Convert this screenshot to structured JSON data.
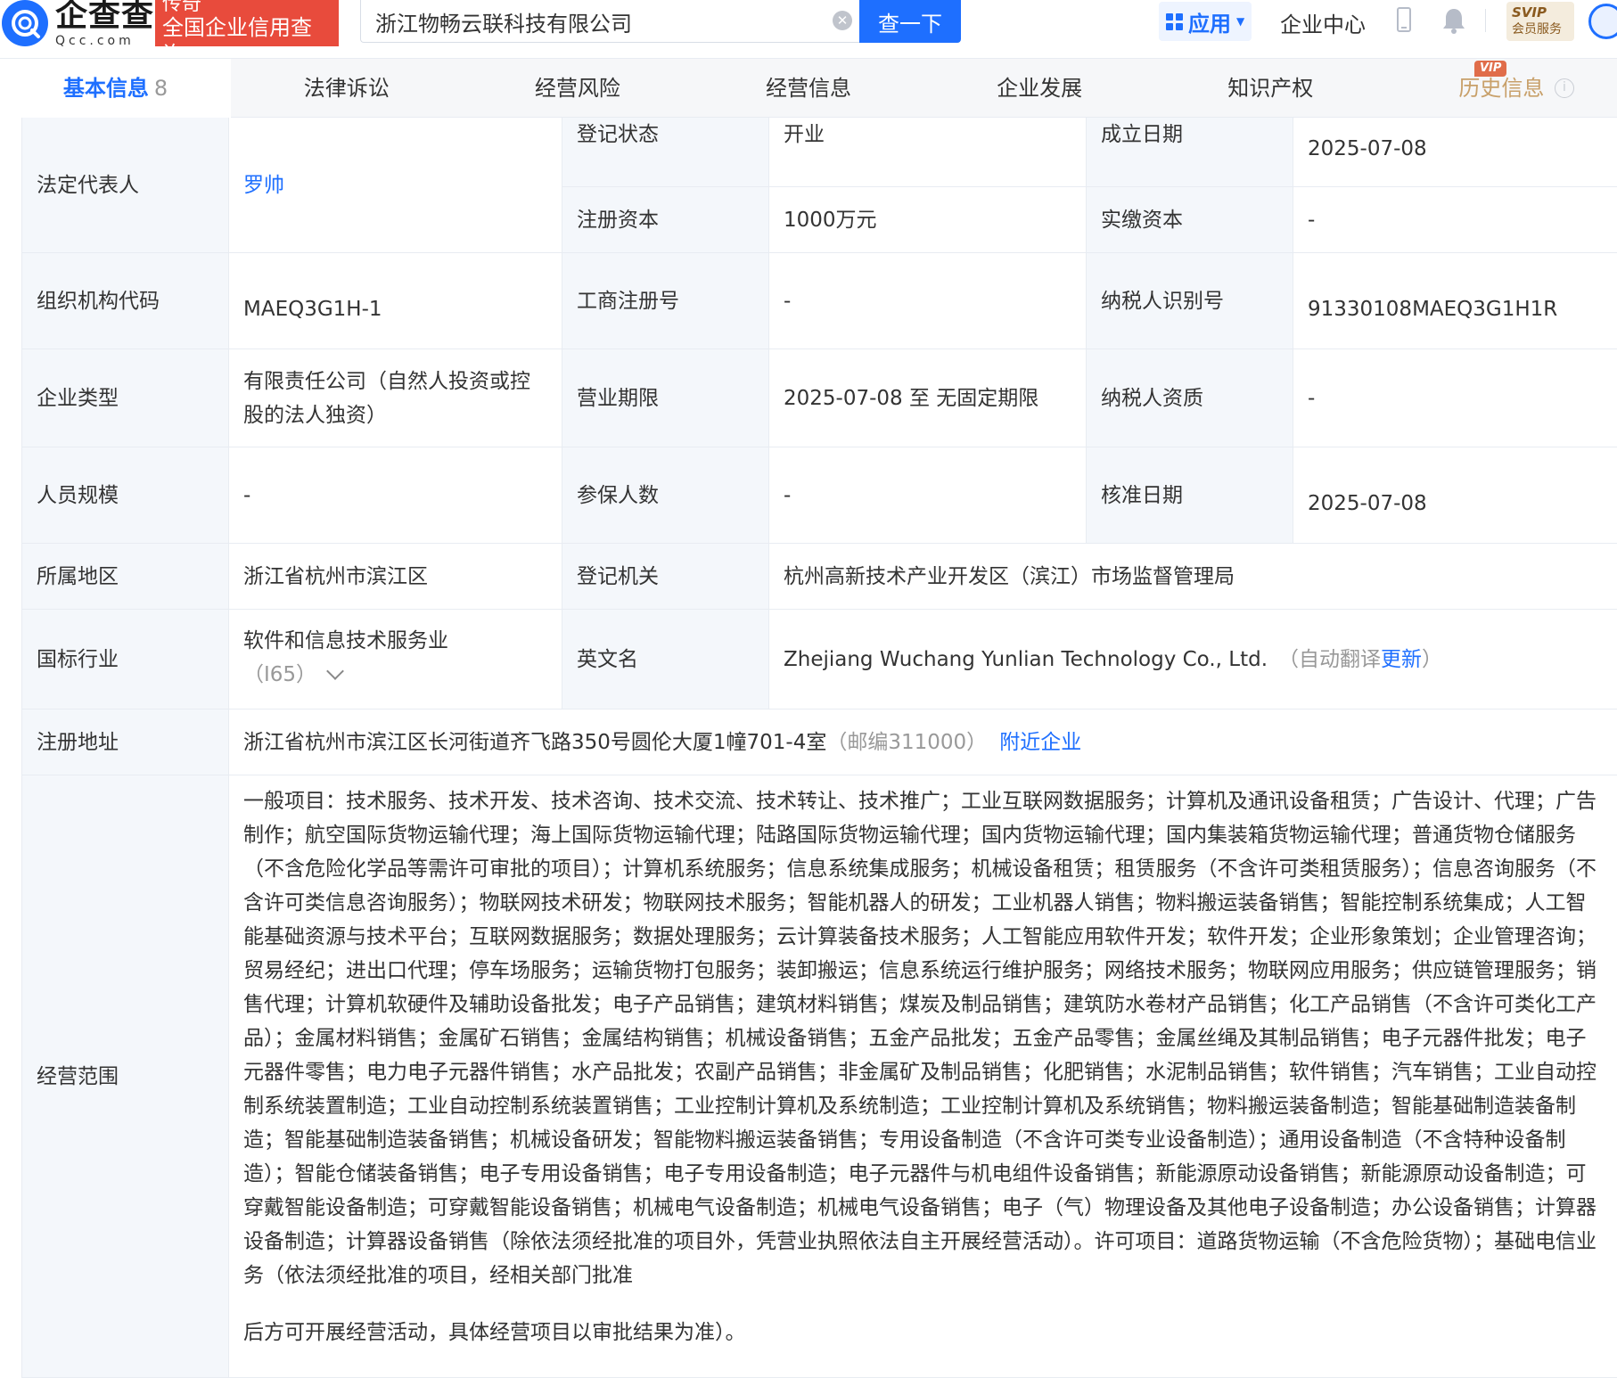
{
  "header": {
    "logo_cn": "企查查",
    "logo_en": "Qcc.com",
    "banner_line1": "传奇",
    "banner_line2": "全国企业信用查询",
    "search_value": "浙江物畅云联科技有限公司",
    "search_button": "查一下",
    "apps_label": "应用",
    "enterprise_center": "企业中心",
    "svip_line1": "SVIP",
    "svip_line2": "会员服务"
  },
  "tabs": [
    {
      "label": "基本信息",
      "count": "8"
    },
    {
      "label": "法律诉讼"
    },
    {
      "label": "经营风险"
    },
    {
      "label": "经营信息"
    },
    {
      "label": "企业发展"
    },
    {
      "label": "知识产权"
    },
    {
      "label": "历史信息",
      "badge": "VIP"
    }
  ],
  "info": {
    "legal_rep_label": "法定代表人",
    "legal_rep_value": "罗帅",
    "reg_status_label": "登记状态",
    "reg_status_value": "开业",
    "founded_label": "成立日期",
    "founded_value": "2025-07-08",
    "reg_capital_label": "注册资本",
    "reg_capital_value": "1000万元",
    "paid_capital_label": "实缴资本",
    "paid_capital_value": "-",
    "org_code_label": "组织机构代码",
    "org_code_value": "MAEQ3G1H-1",
    "biz_reg_no_label": "工商注册号",
    "biz_reg_no_value": "-",
    "taxpayer_id_label": "纳税人识别号",
    "taxpayer_id_value": "91330108MAEQ3G1H1R",
    "company_type_label": "企业类型",
    "company_type_value": "有限责任公司（自然人投资或控股的法人独资）",
    "term_label": "营业期限",
    "term_value": "2025-07-08 至 无固定期限",
    "taxpayer_qual_label": "纳税人资质",
    "taxpayer_qual_value": "-",
    "staff_label": "人员规模",
    "staff_value": "-",
    "insured_label": "参保人数",
    "insured_value": "-",
    "approval_label": "核准日期",
    "approval_value": "2025-07-08",
    "region_label": "所属地区",
    "region_value": "浙江省杭州市滨江区",
    "authority_label": "登记机关",
    "authority_value": "杭州高新技术产业开发区（滨江）市场监督管理局",
    "industry_label": "国标行业",
    "industry_value": "软件和信息技术服务业",
    "industry_code": "（I65）",
    "english_label": "英文名",
    "english_value": "Zhejiang Wuchang Yunlian Technology Co., Ltd.",
    "english_auto_prefix": "（自动翻译",
    "english_update_link": "更新",
    "english_auto_suffix": "）",
    "address_label": "注册地址",
    "address_value": "浙江省杭州市滨江区长河街道齐飞路350号圆伦大厦1幢701-4室",
    "postcode": "（邮编311000）",
    "nearby_link": "附近企业",
    "scope_label": "经营范围",
    "scope_value": "一般项目：技术服务、技术开发、技术咨询、技术交流、技术转让、技术推广；工业互联网数据服务；计算机及通讯设备租赁；广告设计、代理；广告制作；航空国际货物运输代理；海上国际货物运输代理；陆路国际货物运输代理；国内货物运输代理；国内集装箱货物运输代理；普通货物仓储服务（不含危险化学品等需许可审批的项目）；计算机系统服务；信息系统集成服务；机械设备租赁；租赁服务（不含许可类租赁服务）；信息咨询服务（不含许可类信息咨询服务）；物联网技术研发；物联网技术服务；智能机器人的研发；工业机器人销售；物料搬运装备销售；智能控制系统集成；人工智能基础资源与技术平台；互联网数据服务；数据处理服务；云计算装备技术服务；人工智能应用软件开发；软件开发；企业形象策划；企业管理咨询；贸易经纪；进出口代理；停车场服务；运输货物打包服务；装卸搬运；信息系统运行维护服务；网络技术服务；物联网应用服务；供应链管理服务；销售代理；计算机软硬件及辅助设备批发；电子产品销售；建筑材料销售；煤炭及制品销售；建筑防水卷材产品销售；化工产品销售（不含许可类化工产品）；金属材料销售；金属矿石销售；金属结构销售；机械设备销售；五金产品批发；五金产品零售；金属丝绳及其制品销售；电子元器件批发；电子元器件零售；电力电子元器件销售；水产品批发；农副产品销售；非金属矿及制品销售；化肥销售；水泥制品销售；软件销售；汽车销售；工业自动控制系统装置制造；工业自动控制系统装置销售；工业控制计算机及系统制造；工业控制计算机及系统销售；物料搬运装备制造；智能基础制造装备制造；智能基础制造装备销售；机械设备研发；智能物料搬运装备销售；专用设备制造（不含许可类专业设备制造）；通用设备制造（不含特种设备制造）；智能仓储装备销售；电子专用设备销售；电子专用设备制造；电子元器件与机电组件设备销售；新能源原动设备销售；新能源原动设备制造；可穿戴智能设备制造；可穿戴智能设备销售；机械电气设备制造；机械电气设备销售；电子（气）物理设备及其他电子设备制造；办公设备销售；计算器设备制造；计算器设备销售（除依法须经批准的项目外，凭营业执照依法自主开展经营活动）。许可项目：道路货物运输（不含危险货物）；基础电信业务（依法须经批准的项目，经相关部门批准",
    "scope_value_tail": "后方可开展经营活动，具体经营项目以审批结果为准）。"
  },
  "colors": {
    "brand_blue": "#1e6fff",
    "label_bg": "#f4f7fb",
    "banner_red": "#e84b3c",
    "history_gold": "#c8a06a"
  }
}
